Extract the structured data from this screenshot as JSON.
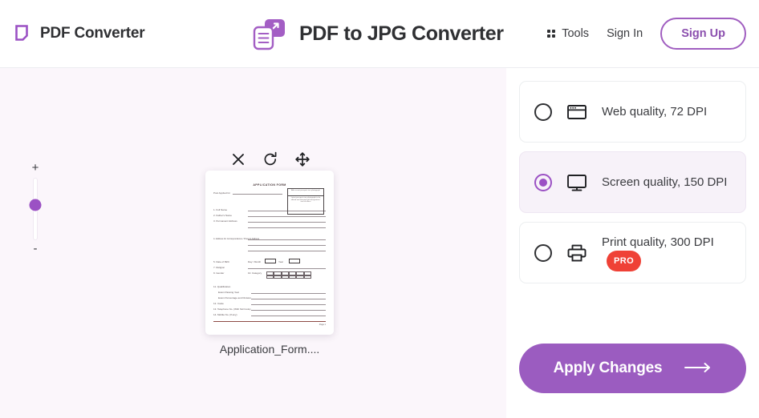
{
  "header": {
    "brand_name": "PDF Converter",
    "brand_icon": "pdf-page-icon",
    "title": "PDF to JPG Converter",
    "title_icon": "pdf-to-jpg-logo-icon",
    "tools_label": "Tools",
    "tools_icon": "grid-dots-icon",
    "sign_in_label": "Sign In",
    "sign_up_label": "Sign Up"
  },
  "canvas": {
    "zoom_in_label": "+",
    "zoom_out_label": "-",
    "toolbar": {
      "close_icon": "close-icon",
      "rotate_icon": "rotate-icon",
      "move_icon": "move-icon"
    },
    "document": {
      "filename": "Application_Form....",
      "page_title": "APPLICATION FORM",
      "post_applied_label": "Post Applied for",
      "photo_box_line1": "Affix recent passport size photograph",
      "photo_box_line2": "Latest passport size photograph to be affixed and attested with designation / seal of officer",
      "fields": [
        "1. Full Name",
        "2. Father's Name",
        "3. Permanent Address",
        "4. Address for Correspondence / Present Address",
        "5. Date of Birth",
        "6. Age",
        "7. Religion",
        "8. Nationality",
        "9. Gender",
        "10. Category",
        "11. Qualification",
        "Exam Passing Year",
        "Exam Percentage and Division",
        "12. Caste",
        "13. Telephone No. (With Std Code)",
        "14. Mobile No. (If any)"
      ],
      "inline_fields": [
        "Day / Month",
        "Year",
        "Caste"
      ],
      "page_footer": "Page 1"
    }
  },
  "panel": {
    "options": [
      {
        "label": "Web quality, 72 DPI",
        "icon": "browser-window-icon",
        "selected": false,
        "pro": false
      },
      {
        "label": "Screen quality, 150 DPI",
        "icon": "monitor-icon",
        "selected": true,
        "pro": false
      },
      {
        "label": "Print quality, 300 DPI",
        "icon": "printer-icon",
        "selected": false,
        "pro": true,
        "pro_label": "PRO"
      }
    ],
    "apply_label": "Apply Changes",
    "apply_icon": "arrow-right-icon"
  },
  "colors": {
    "accent_purple": "#9b51c4",
    "apply_button": "#9b5cc0",
    "pro_red": "#ef4136",
    "canvas_bg": "#fbf6fb",
    "text": "#3b3c40"
  }
}
